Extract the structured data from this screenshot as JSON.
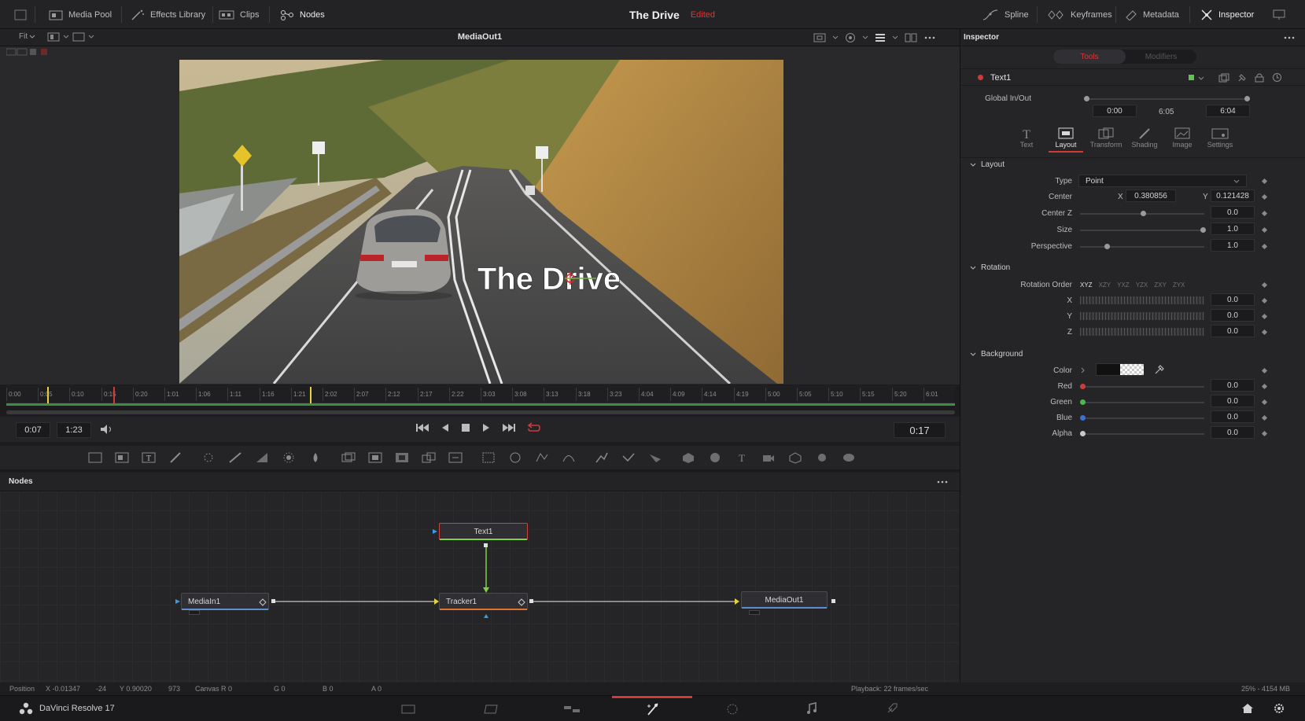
{
  "app": {
    "name": "DaVinci Resolve 17"
  },
  "topbar": {
    "media_pool": "Media Pool",
    "effects_library": "Effects Library",
    "clips": "Clips",
    "nodes": "Nodes",
    "project_title": "The Drive",
    "project_status": "Edited",
    "spline": "Spline",
    "keyframes": "Keyframes",
    "metadata": "Metadata",
    "inspector": "Inspector"
  },
  "viewer": {
    "fit_label": "Fit",
    "title": "MediaOut1",
    "overlay_text": "The Drive"
  },
  "timeline": {
    "ticks": [
      "0:00",
      "0:05",
      "0:10",
      "0:15",
      "0:20",
      "1:01",
      "1:06",
      "1:11",
      "1:16",
      "1:21",
      "2:02",
      "2:07",
      "2:12",
      "2:17",
      "2:22",
      "3:03",
      "3:08",
      "3:13",
      "3:18",
      "3:23",
      "4:04",
      "4:09",
      "4:14",
      "4:19",
      "5:00",
      "5:05",
      "5:10",
      "5:15",
      "5:20",
      "6:01"
    ]
  },
  "transport": {
    "in_time": "0:07",
    "out_time": "1:23",
    "current_time": "0:17"
  },
  "nodes_panel": {
    "title": "Nodes",
    "nodes": {
      "text1": "Text1",
      "mediain1": "MediaIn1",
      "tracker1": "Tracker1",
      "mediaout1": "MediaOut1"
    }
  },
  "status": {
    "position_label": "Position",
    "pos_x": "X -0.01347",
    "pos_x_px": "-24",
    "pos_y": "Y 0.90020",
    "pos_y_px": "973",
    "canvas": "Canvas  R 0",
    "g": "G 0",
    "b": "B 0",
    "a": "A 0",
    "playback": "Playback: 22 frames/sec",
    "memory": "25% - 4154 MB"
  },
  "inspector": {
    "title": "Inspector",
    "tabs": {
      "tools": "Tools",
      "modifiers": "Modifiers"
    },
    "node_name": "Text1",
    "global_inout_label": "Global In/Out",
    "global_in": "0:00",
    "global_mid": "6:05",
    "global_out": "6:04",
    "subtabs": {
      "text": "Text",
      "layout": "Layout",
      "transform": "Transform",
      "shading": "Shading",
      "image": "Image",
      "settings": "Settings"
    },
    "layout": {
      "section": "Layout",
      "type_label": "Type",
      "type_value": "Point",
      "center_label": "Center",
      "center_x_label": "X",
      "center_x": "0.380856",
      "center_y_label": "Y",
      "center_y": "0.121428",
      "center_z_label": "Center Z",
      "center_z": "0.0",
      "size_label": "Size",
      "size": "1.0",
      "perspective_label": "Perspective",
      "perspective": "1.0"
    },
    "rotation": {
      "section": "Rotation",
      "order_label": "Rotation Order",
      "orders": [
        "XYZ",
        "XZY",
        "YXZ",
        "YZX",
        "ZXY",
        "ZYX"
      ],
      "x_label": "X",
      "x": "0.0",
      "y_label": "Y",
      "y": "0.0",
      "z_label": "Z",
      "z": "0.0"
    },
    "background": {
      "section": "Background",
      "color_label": "Color",
      "red_label": "Red",
      "red": "0.0",
      "green_label": "Green",
      "green": "0.0",
      "blue_label": "Blue",
      "blue": "0.0",
      "alpha_label": "Alpha",
      "alpha": "0.0"
    }
  },
  "colors": {
    "accent_red": "#d23a3a",
    "tracker_orange": "#e0732a",
    "connector_green": "#7fd13f"
  }
}
